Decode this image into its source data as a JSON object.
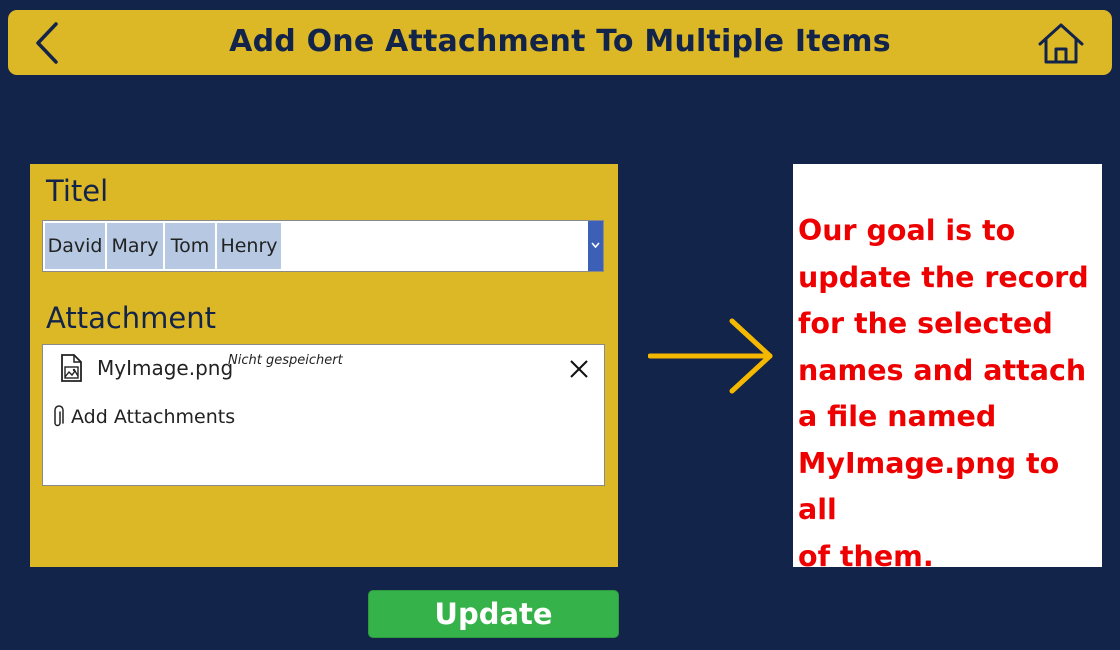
{
  "header": {
    "title": "Add One Attachment To Multiple Items",
    "back_icon": "chevron-left-icon",
    "home_icon": "home-icon"
  },
  "form": {
    "title_label": "Titel",
    "selected_names": [
      "David",
      "Mary",
      "Tom",
      "Henry"
    ],
    "dropdown_icon": "chevron-down-icon",
    "attachment_label": "Attachment",
    "attachment": {
      "file_name": "MyImage.png",
      "status": "Nicht gespeichert",
      "file_icon": "image-file-icon",
      "remove_icon": "close-icon"
    },
    "add_attachments_label": "Add Attachments",
    "add_icon": "paperclip-icon"
  },
  "goal": {
    "lines": [
      "Our goal is to",
      "update the record",
      "for the selected",
      "names and attach",
      "a file named",
      "MyImage.png to all",
      "of them."
    ]
  },
  "update_button": {
    "label": "Update"
  },
  "colors": {
    "background": "#13244a",
    "header": "#dcb726",
    "card": "#dcb726",
    "chip": "#b7c8e3",
    "dropdown": "#3b60b5",
    "goal_text": "#ee0000",
    "arrow": "#f5b800",
    "button": "#36b24a"
  }
}
